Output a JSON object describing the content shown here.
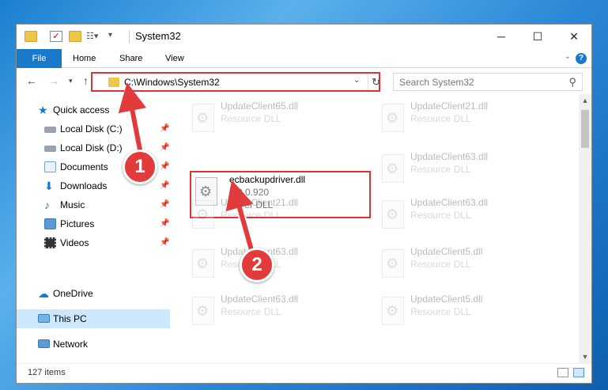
{
  "window": {
    "title": "System32",
    "controls": {
      "minimize": "─",
      "maximize": "☐",
      "close": "✕"
    }
  },
  "ribbon": {
    "tabs": [
      "File",
      "Home",
      "Share",
      "View"
    ],
    "help": "?"
  },
  "address": {
    "path": "C:\\Windows\\System32",
    "search_placeholder": "Search System32"
  },
  "sidebar": {
    "items": [
      {
        "label": "Quick access",
        "icon": "star-icon",
        "pinned": false
      },
      {
        "label": "Local Disk (C:)",
        "icon": "drive-icon",
        "pinned": true
      },
      {
        "label": "Local Disk (D:)",
        "icon": "drive-icon",
        "pinned": true
      },
      {
        "label": "Documents",
        "icon": "documents-icon",
        "pinned": true
      },
      {
        "label": "Downloads",
        "icon": "download-icon",
        "pinned": true
      },
      {
        "label": "Music",
        "icon": "music-icon",
        "pinned": true
      },
      {
        "label": "Pictures",
        "icon": "pictures-icon",
        "pinned": true
      },
      {
        "label": "Videos",
        "icon": "videos-icon",
        "pinned": true
      },
      {
        "label": "OneDrive",
        "icon": "cloud-icon",
        "pinned": false
      },
      {
        "label": "This PC",
        "icon": "computer-icon",
        "pinned": false
      },
      {
        "label": "Network",
        "icon": "network-icon",
        "pinned": false
      }
    ]
  },
  "files": [
    {
      "name": "UpdateClient65.dll",
      "type": "Resource DLL"
    },
    {
      "name": "UpdateClient21.dll",
      "type": "Resource DLL"
    },
    {
      "name": "ecbackupdriver.dll",
      "version": "7.0.0.920",
      "type": "driver DLL"
    },
    {
      "name": "UpdateClient63.dll",
      "type": "Resource DLL"
    },
    {
      "name": "UpdateClient21.dll",
      "type": "Resource DLL"
    },
    {
      "name": "UpdateClient63.dll",
      "type": "Resource DLL"
    },
    {
      "name": "UpdateClient63.dll",
      "type": "Resource DLL"
    },
    {
      "name": "UpdateClient5.dll",
      "type": "Resource DLL"
    },
    {
      "name": "UpdateClient63.dll",
      "type": "Resource DLL"
    },
    {
      "name": "UpdateClient5.dll",
      "type": "Resource DLL"
    }
  ],
  "status": {
    "count": "127 items"
  },
  "annotations": {
    "step1": "1",
    "step2": "2"
  },
  "colors": {
    "accent": "#1979ca",
    "highlight": "#dd3333",
    "selected": "#cce8ff"
  }
}
